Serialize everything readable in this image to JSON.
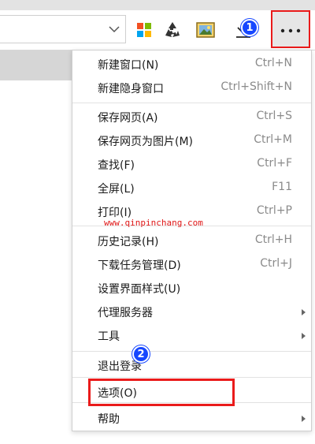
{
  "toolbar": {
    "icons": [
      "chevron-down-icon",
      "windows-icon",
      "recycle-icon",
      "image-icon",
      "download-icon",
      "more-icon"
    ],
    "menu_button_label": "···"
  },
  "badges": {
    "first": "1",
    "second": "2"
  },
  "watermark": "www.qinpinchang.com",
  "menu": {
    "items": [
      {
        "label": "新建窗口(N)",
        "shortcut": "Ctrl+N"
      },
      {
        "label": "新建隐身窗口",
        "shortcut": "Ctrl+Shift+N"
      },
      {
        "label": "保存网页(A)",
        "shortcut": "Ctrl+S"
      },
      {
        "label": "保存网页为图片(M)",
        "shortcut": "Ctrl+M"
      },
      {
        "label": "查找(F)",
        "shortcut": "Ctrl+F"
      },
      {
        "label": "全屏(L)",
        "shortcut": "F11"
      },
      {
        "label": "打印(I)",
        "shortcut": "Ctrl+P"
      },
      {
        "label": "历史记录(H)",
        "shortcut": "Ctrl+H"
      },
      {
        "label": "下载任务管理(D)",
        "shortcut": "Ctrl+J"
      },
      {
        "label": "设置界面样式(U)",
        "shortcut": ""
      },
      {
        "label": "代理服务器",
        "shortcut": ""
      },
      {
        "label": "工具",
        "shortcut": ""
      },
      {
        "label": "退出登录",
        "shortcut": ""
      },
      {
        "label": "选项(O)",
        "shortcut": ""
      },
      {
        "label": "帮助",
        "shortcut": ""
      }
    ]
  },
  "colors": {
    "highlight_red": "#ea1b1b",
    "badge_blue": "#1747ff"
  }
}
